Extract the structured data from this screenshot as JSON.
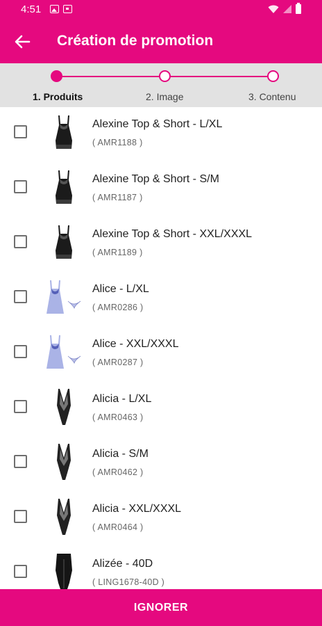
{
  "status_bar": {
    "time": "4:51",
    "left_icons": [
      "image-icon",
      "notification-icon"
    ],
    "right_icons": [
      "wifi-icon",
      "signal-icon",
      "battery-icon"
    ]
  },
  "app_bar": {
    "title": "Création de promotion",
    "back_icon": "arrow-left-icon"
  },
  "colors": {
    "brand": "#e5097f",
    "stepper_bg": "#e2e2e2"
  },
  "stepper": {
    "steps": [
      {
        "label": "1. Produits",
        "active": true
      },
      {
        "label": "2. Image",
        "active": false
      },
      {
        "label": "3. Contenu",
        "active": false
      }
    ]
  },
  "products": [
    {
      "name": "Alexine Top & Short - L/XL",
      "ref": "( AMR1188 )",
      "thumb": "black-babydoll"
    },
    {
      "name": "Alexine Top & Short - S/M",
      "ref": "( AMR1187 )",
      "thumb": "black-babydoll"
    },
    {
      "name": "Alexine Top & Short - XXL/XXXL",
      "ref": "( AMR1189 )",
      "thumb": "black-babydoll"
    },
    {
      "name": "Alice - L/XL",
      "ref": "( AMR0286 )",
      "thumb": "blue-chemise"
    },
    {
      "name": "Alice - XXL/XXXL",
      "ref": "( AMR0287 )",
      "thumb": "blue-chemise"
    },
    {
      "name": "Alicia - L/XL",
      "ref": "( AMR0463 )",
      "thumb": "black-bodysuit"
    },
    {
      "name": "Alicia - S/M",
      "ref": "( AMR0462 )",
      "thumb": "black-bodysuit"
    },
    {
      "name": "Alicia - XXL/XXXL",
      "ref": "( AMR0464 )",
      "thumb": "black-bodysuit"
    },
    {
      "name": "Alizée - 40D",
      "ref": "( LING1678-40D )",
      "thumb": "black-swimsuit"
    }
  ],
  "footer": {
    "button_label": "IGNORER"
  }
}
